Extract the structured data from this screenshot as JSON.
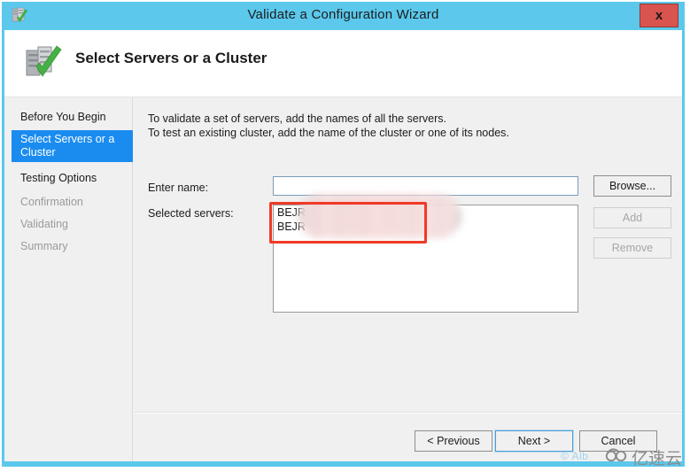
{
  "window": {
    "title": "Validate a Configuration Wizard",
    "title_icon": "cluster-validate-icon",
    "close_label": "x",
    "titlebar_color": "#5bc8ec"
  },
  "header": {
    "icon": "server-cluster-check-icon",
    "title": "Select Servers or a Cluster"
  },
  "sidebar": {
    "items": [
      {
        "label": "Before You Begin",
        "state": "normal"
      },
      {
        "label": "Select Servers or a Cluster",
        "state": "active"
      },
      {
        "label": "Testing Options",
        "state": "normal"
      },
      {
        "label": "Confirmation",
        "state": "dim"
      },
      {
        "label": "Validating",
        "state": "dim"
      },
      {
        "label": "Summary",
        "state": "dim"
      }
    ],
    "active_color": "#1a8cf0"
  },
  "content": {
    "intro_line1": "To validate a set of servers, add the names of all the servers.",
    "intro_line2": "To test an existing cluster, add the name of the cluster or one of its nodes.",
    "enter_name_label": "Enter name:",
    "enter_name_value": "",
    "enter_name_placeholder": "",
    "selected_servers_label": "Selected servers:",
    "selected_servers": [
      "BEJR",
      "BEJR"
    ],
    "buttons": {
      "browse": "Browse...",
      "add": "Add",
      "remove": "Remove"
    },
    "annotation_color": "#ef3a26"
  },
  "footer": {
    "previous": "< Previous",
    "next": "Next >",
    "cancel": "Cancel"
  },
  "watermark": {
    "alb": "© Alb",
    "brand": "亿速云"
  }
}
